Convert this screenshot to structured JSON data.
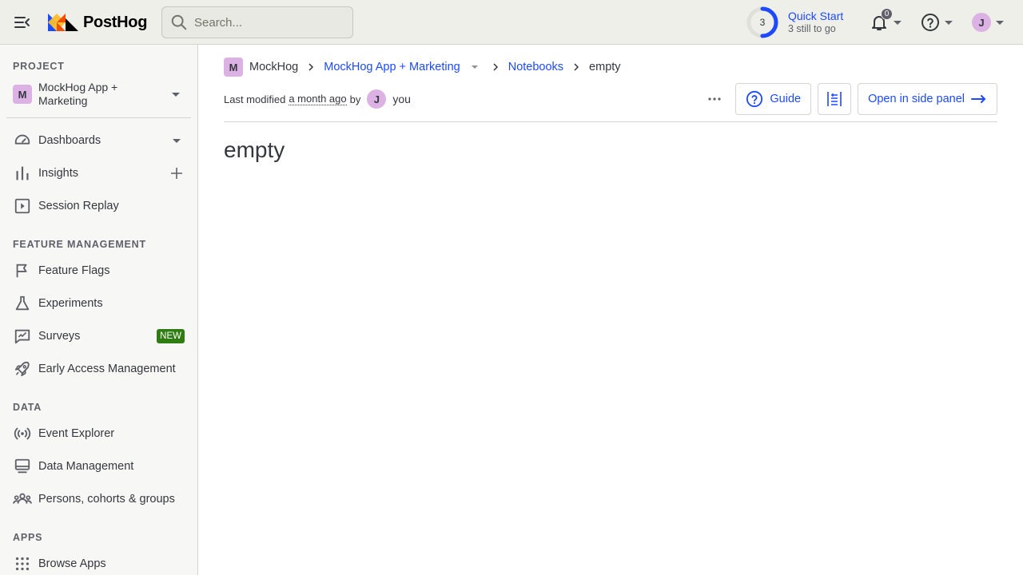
{
  "topbar": {
    "logo_text": "PostHog",
    "search_placeholder": "Search...",
    "quick_start": {
      "count": "3",
      "title": "Quick Start",
      "subtitle": "3 still to go",
      "progress": 0.5
    },
    "notifications_count": "0",
    "user_initial": "J"
  },
  "sidebar": {
    "project_section": "PROJECT",
    "project_badge": "M",
    "project_name": "MockHog App + Marketing",
    "items_top": [
      {
        "label": "Dashboards",
        "icon": "dashboard-icon"
      },
      {
        "label": "Insights",
        "icon": "bar-chart-icon"
      },
      {
        "label": "Session Replay",
        "icon": "play-square-icon"
      }
    ],
    "feature_section": "FEATURE MANAGEMENT",
    "items_feature": [
      {
        "label": "Feature Flags",
        "icon": "flag-icon"
      },
      {
        "label": "Experiments",
        "icon": "flask-icon"
      },
      {
        "label": "Surveys",
        "icon": "survey-icon",
        "badge": "NEW"
      },
      {
        "label": "Early Access Management",
        "icon": "rocket-icon"
      }
    ],
    "data_section": "DATA",
    "items_data": [
      {
        "label": "Event Explorer",
        "icon": "broadcast-icon"
      },
      {
        "label": "Data Management",
        "icon": "server-icon"
      },
      {
        "label": "Persons, cohorts & groups",
        "icon": "people-icon"
      }
    ],
    "apps_section": "APPS",
    "items_apps": [
      {
        "label": "Browse Apps",
        "icon": "apps-grid-icon"
      }
    ]
  },
  "main": {
    "breadcrumb": {
      "badge": "M",
      "org": "MockHog",
      "project": "MockHog App + Marketing",
      "section": "Notebooks",
      "current": "empty"
    },
    "meta": {
      "prefix": "Last modified",
      "when": "a month ago",
      "by": "by",
      "user_initial": "J",
      "user": "you"
    },
    "toolbar": {
      "guide_label": "Guide",
      "side_panel_label": "Open in side panel"
    },
    "title": "empty"
  },
  "colors": {
    "accent": "#1d4aff",
    "new_badge": "#2f7d12",
    "avatar": "#dcb1e3",
    "topbar_bg": "#eeefe9",
    "sidebar_bg": "#f7f7f5"
  }
}
